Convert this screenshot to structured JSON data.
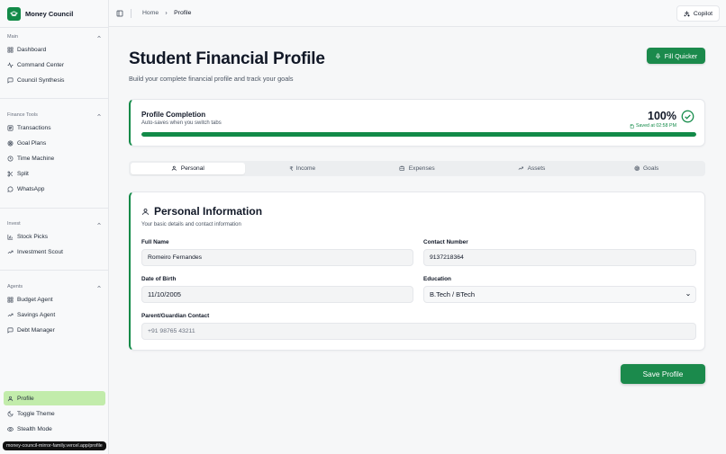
{
  "brand": {
    "name": "Money Council"
  },
  "sidebar": {
    "sections": [
      {
        "title": "Main",
        "items": [
          {
            "label": "Dashboard",
            "icon": "grid-icon"
          },
          {
            "label": "Command Center",
            "icon": "activity-icon"
          },
          {
            "label": "Council Synthesis",
            "icon": "chat-icon"
          }
        ]
      },
      {
        "title": "Finance Tools",
        "items": [
          {
            "label": "Transactions",
            "icon": "list-icon"
          },
          {
            "label": "Goal Plans",
            "icon": "target-icon"
          },
          {
            "label": "Time Machine",
            "icon": "clock-icon"
          },
          {
            "label": "Split",
            "icon": "split-icon"
          },
          {
            "label": "WhatsApp",
            "icon": "message-icon"
          }
        ]
      },
      {
        "title": "Invest",
        "items": [
          {
            "label": "Stock Picks",
            "icon": "bar-chart-icon"
          },
          {
            "label": "Investment Scout",
            "icon": "trend-icon"
          }
        ]
      },
      {
        "title": "Agents",
        "items": [
          {
            "label": "Budget Agent",
            "icon": "grid-icon"
          },
          {
            "label": "Savings Agent",
            "icon": "trend-icon"
          },
          {
            "label": "Debt Manager",
            "icon": "chat-icon"
          }
        ]
      }
    ],
    "bottom": [
      {
        "label": "Profile",
        "icon": "user-icon",
        "active": true
      },
      {
        "label": "Toggle Theme",
        "icon": "moon-icon"
      },
      {
        "label": "Stealth Mode",
        "icon": "eye-icon"
      }
    ],
    "status_url": "money-council-mirror-family.vercel.app/profile"
  },
  "topbar": {
    "breadcrumb": [
      "Home",
      "Profile"
    ],
    "copilot_label": "Copilot"
  },
  "page": {
    "title": "Student Financial Profile",
    "subtitle": "Build your complete financial profile and track your goals",
    "fill_quicker_label": "Fill Quicker"
  },
  "completion": {
    "title": "Profile Completion",
    "subtitle": "Auto-saves when you switch tabs",
    "percent_label": "100%",
    "percent": 100,
    "saved_label": "Saved at 02:58 PM"
  },
  "tabs": [
    {
      "label": "Personal",
      "icon": "user-icon",
      "active": true
    },
    {
      "label": "Income",
      "icon": "rupee-icon",
      "prefix": "₹"
    },
    {
      "label": "Expenses",
      "icon": "wallet-icon"
    },
    {
      "label": "Assets",
      "icon": "trend-icon"
    },
    {
      "label": "Goals",
      "icon": "target-icon"
    }
  ],
  "personal": {
    "title": "Personal Information",
    "subtitle": "Your basic details and contact information",
    "fields": {
      "full_name": {
        "label": "Full Name",
        "value": "Romeiro Fernandes"
      },
      "contact": {
        "label": "Contact Number",
        "value": "9137218364"
      },
      "dob": {
        "label": "Date of Birth",
        "value": "11/10/2005"
      },
      "education": {
        "label": "Education",
        "value": "B.Tech / BTech"
      },
      "guardian": {
        "label": "Parent/Guardian Contact",
        "placeholder": "+91 98765 43211"
      }
    }
  },
  "save_label": "Save Profile",
  "colors": {
    "accent": "#128a48",
    "active_nav": "#c2ecab"
  }
}
